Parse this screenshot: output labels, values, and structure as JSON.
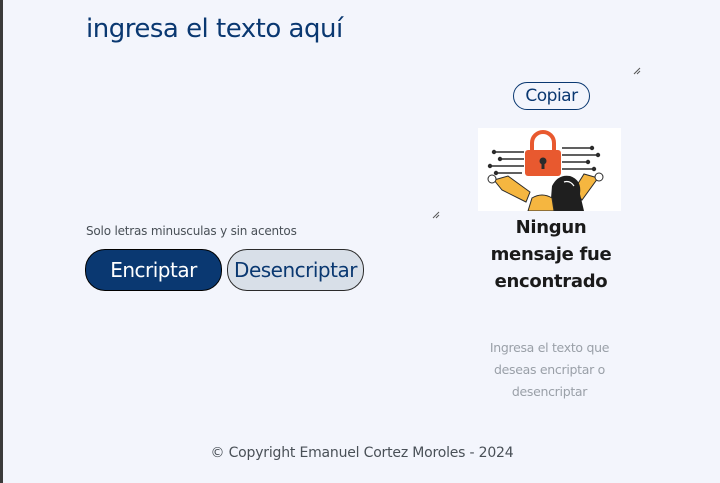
{
  "input": {
    "placeholder": "ingresa el texto aquí"
  },
  "hint": {
    "text": "Solo letras minusculas y sin acentos"
  },
  "buttons": {
    "encrypt_label": "Encriptar",
    "decrypt_label": "Desencriptar",
    "copy_label": "Copiar"
  },
  "output": {
    "title": "Ningun mensaje fue encontrado",
    "subtitle": "Ingresa el texto que deseas encriptar o desencriptar"
  },
  "footer": {
    "text": "© Copyright Emanuel Cortez Moroles - 2024"
  },
  "colors": {
    "primary": "#0a3871",
    "background": "#f3f5fc",
    "secondary_button": "#d8dfe8",
    "lock": "#e8592f",
    "sleeve": "#f5b640"
  },
  "icons": {
    "illustration": "lock-illustration-icon"
  }
}
